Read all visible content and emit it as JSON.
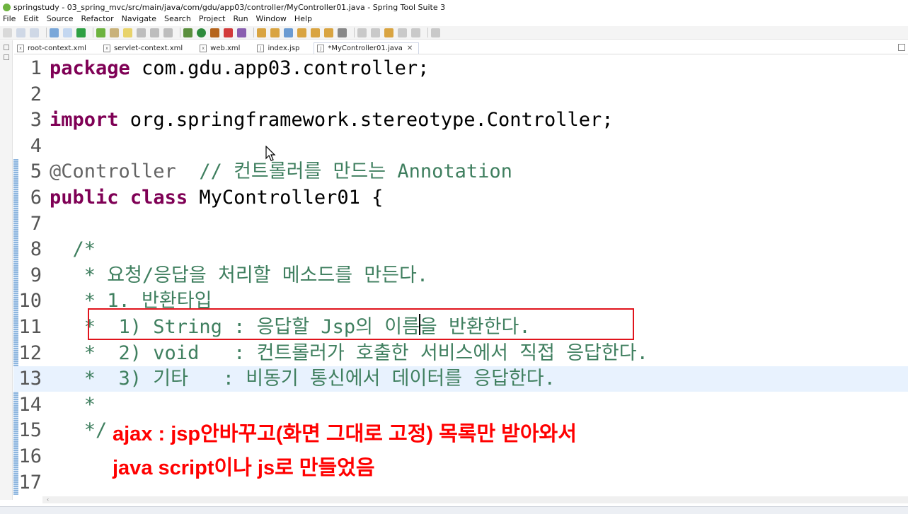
{
  "window": {
    "title": "springstudy - 03_spring_mvc/src/main/java/com/gdu/app03/controller/MyController01.java - Spring Tool Suite 3"
  },
  "menu": [
    "File",
    "Edit",
    "Source",
    "Refactor",
    "Navigate",
    "Search",
    "Project",
    "Run",
    "Window",
    "Help"
  ],
  "tabs": [
    {
      "label": "root-context.xml",
      "icon": "xml-file-icon",
      "active": false
    },
    {
      "label": "servlet-context.xml",
      "icon": "xml-file-icon",
      "active": false
    },
    {
      "label": "web.xml",
      "icon": "xml-file-icon",
      "active": false
    },
    {
      "label": "index.jsp",
      "icon": "jsp-file-icon",
      "active": false
    },
    {
      "label": "*MyController01.java",
      "icon": "java-file-icon",
      "active": true
    }
  ],
  "editor": {
    "lines": [
      {
        "n": "1",
        "tokens": [
          {
            "t": "kw",
            "v": "package"
          },
          {
            "t": "plain",
            "v": " com.gdu.app03.controller;"
          }
        ]
      },
      {
        "n": "2",
        "tokens": []
      },
      {
        "n": "3",
        "tokens": [
          {
            "t": "kw",
            "v": "import"
          },
          {
            "t": "plain",
            "v": " org.springframework.stereotype.Controller;"
          }
        ]
      },
      {
        "n": "4",
        "tokens": []
      },
      {
        "n": "5",
        "tokens": [
          {
            "t": "ann",
            "v": "@Controller"
          },
          {
            "t": "plain",
            "v": "  "
          },
          {
            "t": "cm",
            "v": "// 컨트롤러를 만드는 Annotation"
          }
        ]
      },
      {
        "n": "6",
        "tokens": [
          {
            "t": "kw",
            "v": "public"
          },
          {
            "t": "plain",
            "v": " "
          },
          {
            "t": "kw",
            "v": "class"
          },
          {
            "t": "plain",
            "v": " MyController01 {"
          }
        ]
      },
      {
        "n": "7",
        "tokens": []
      },
      {
        "n": "8",
        "tokens": [
          {
            "t": "cm",
            "v": "  /*"
          }
        ]
      },
      {
        "n": "9",
        "tokens": [
          {
            "t": "cm",
            "v": "   * 요청/응답을 처리할 메소드를 만든다."
          }
        ]
      },
      {
        "n": "10",
        "tokens": [
          {
            "t": "cm",
            "v": "   * 1. 반환타입"
          }
        ]
      },
      {
        "n": "11",
        "tokens": [
          {
            "t": "cm",
            "v": "   *  1) String : 응답할 Jsp의 이름을 반환한다."
          }
        ]
      },
      {
        "n": "12",
        "tokens": [
          {
            "t": "cm",
            "v": "   *  2) void   : 컨트롤러가 호출한 서비스에서 직접 응답한다."
          }
        ]
      },
      {
        "n": "13",
        "tokens": [
          {
            "t": "cm",
            "v": "   *  3) 기타   : 비동기 통신에서 데이터를 응답한다."
          }
        ]
      },
      {
        "n": "14",
        "tokens": [
          {
            "t": "cm",
            "v": "   *"
          }
        ]
      },
      {
        "n": "15",
        "tokens": [
          {
            "t": "cm",
            "v": "   */"
          }
        ]
      },
      {
        "n": "16",
        "tokens": []
      },
      {
        "n": "17",
        "tokens": []
      }
    ]
  },
  "annotation": {
    "note_line1": "ajax : jsp안바꾸고(화면 그대로 고정) 목록만 받아와서",
    "note_line2": "java script이나 js로 만들었음",
    "color": "#ff0000"
  },
  "colors": {
    "keyword": "#7f0055",
    "annotation": "#646464",
    "comment": "#3f7f5f",
    "current_line": "#e8f2fe",
    "highlight_box": "#e0141c"
  }
}
